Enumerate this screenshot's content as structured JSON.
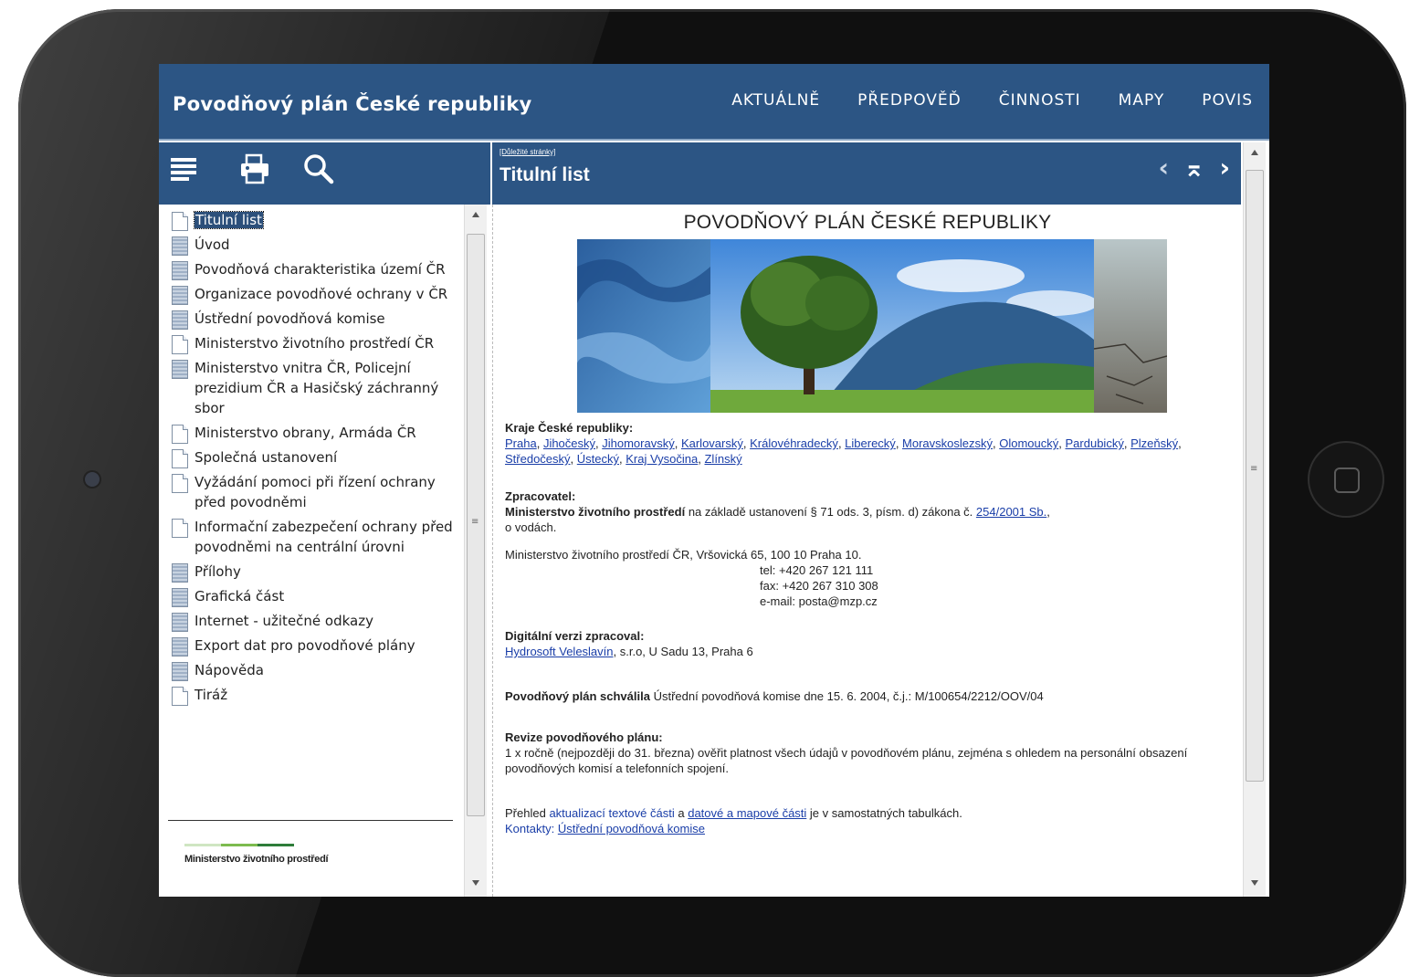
{
  "app": {
    "title": "Povodňový plán České republiky",
    "nav": [
      "AKTUÁLNĚ",
      "PŘEDPOVĚĎ",
      "ČINNOSTI",
      "MAPY",
      "POVIS"
    ]
  },
  "toolbar": {
    "icons": [
      "menu-icon",
      "print-icon",
      "search-icon"
    ]
  },
  "sidebar": {
    "items": [
      {
        "label": "Titulní list",
        "icon": "page",
        "selected": true
      },
      {
        "label": "Úvod",
        "icon": "book"
      },
      {
        "label": "Povodňová charakteristika území ČR",
        "icon": "book"
      },
      {
        "label": "Organizace povodňové ochrany v ČR",
        "icon": "book"
      },
      {
        "label": "Ústřední povodňová komise",
        "icon": "book"
      },
      {
        "label": "Ministerstvo životního prostředí ČR",
        "icon": "page"
      },
      {
        "label": "Ministerstvo vnitra ČR, Policejní prezidium ČR a Hasičský záchranný sbor",
        "icon": "book"
      },
      {
        "label": "Ministerstvo obrany, Armáda ČR",
        "icon": "page"
      },
      {
        "label": "Společná ustanovení",
        "icon": "page"
      },
      {
        "label": "Vyžádání pomoci při řízení ochrany před povodněmi",
        "icon": "page"
      },
      {
        "label": "Informační zabezpečení ochrany před povodněmi na centrální úrovni",
        "icon": "page"
      },
      {
        "label": "Přílohy",
        "icon": "book"
      },
      {
        "label": "Grafická část",
        "icon": "book"
      },
      {
        "label": "Internet - užitečné odkazy",
        "icon": "book"
      },
      {
        "label": "Export dat pro povodňové plány",
        "icon": "book"
      },
      {
        "label": "Nápověda",
        "icon": "book"
      },
      {
        "label": "Tiráž",
        "icon": "page"
      }
    ],
    "logo_text": "Ministerstvo životního prostředí",
    "logo_colors": [
      "#cfe6c2",
      "#7dbb4f",
      "#2e7d3a"
    ]
  },
  "content_header": {
    "breadcrumb": "[Důležité stránky]",
    "title": "Titulní list",
    "arrows": [
      "‹",
      "⌅",
      "›"
    ]
  },
  "document": {
    "heading": "POVODŇOVÝ PLÁN ČESKÉ REPUBLIKY",
    "kraje_label": "Kraje České republiky:",
    "kraje": [
      "Praha",
      "Jihočeský",
      "Jihomoravský",
      "Karlovarský",
      "Královéhradecký",
      "Liberecký",
      "Moravskoslezský",
      "Olomoucký",
      "Pardubický",
      "Plzeňský",
      "Středočeský",
      "Ústecký",
      "Kraj Vysočina",
      "Zlínský"
    ],
    "zpracovatel_label": "Zpracovatel:",
    "zpracovatel_org": "Ministerstvo životního prostředí",
    "zpracovatel_text": "na základě ustanovení § 71 ods. 3, písm. d) zákona č.",
    "law_link": "254/2001 Sb.",
    "law_tail": "o vodách.",
    "address": "Ministerstvo životního prostředí ČR, Vršovická 65, 100 10 Praha 10.",
    "tel": "tel: +420 267 121 111",
    "fax": "fax: +420 267 310 308",
    "email": "e-mail: posta@mzp.cz",
    "digital_label": "Digitální verzi zpracoval:",
    "digital_link": "Hydrosoft Veleslavín",
    "digital_text": ", s.r.o, U Sadu 13, Praha 6",
    "approved_bold": "Povodňový plán schválila",
    "approved_text": "Ústřední povodňová komise dne 15. 6. 2004, č.j.: M/100654/2212/OOV/04",
    "revision_label": "Revize povodňového plánu:",
    "revision_text": "1 x ročně (nejpozději do 31. března) ověřit platnost všech údajů v povodňovém plánu, zejména s ohledem na personální obsazení povodňových komisí a telefonních spojení.",
    "overview_pre": "Přehled",
    "overview_link1": "aktualizací textové části",
    "overview_mid": "a",
    "overview_link2": "datové a mapové části",
    "overview_post": "je v samostatných tabulkách.",
    "contacts_pre": "Kontakty:",
    "contacts_link": "Ústřední povodňová komise"
  },
  "colors": {
    "header_blue": "#2c5584",
    "link_blue": "#1a3ea8",
    "selected_bg": "#2c4f7a"
  }
}
